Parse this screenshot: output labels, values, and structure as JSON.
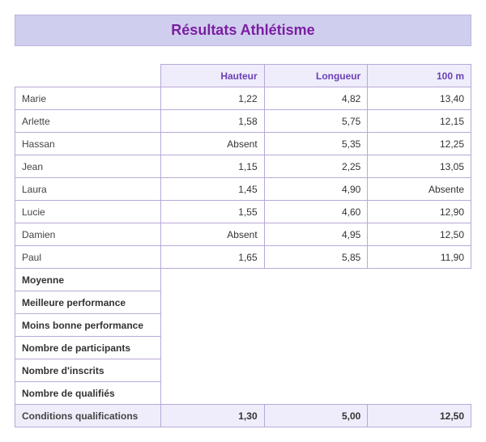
{
  "title": "Résultats Athlétisme",
  "columns": [
    "Hauteur",
    "Longueur",
    "100 m"
  ],
  "rows": [
    {
      "name": "Marie",
      "values": [
        "1,22",
        "4,82",
        "13,40"
      ]
    },
    {
      "name": "Arlette",
      "values": [
        "1,58",
        "5,75",
        "12,15"
      ]
    },
    {
      "name": "Hassan",
      "values": [
        "Absent",
        "5,35",
        "12,25"
      ]
    },
    {
      "name": "Jean",
      "values": [
        "1,15",
        "2,25",
        "13,05"
      ]
    },
    {
      "name": "Laura",
      "values": [
        "1,45",
        "4,90",
        "Absente"
      ]
    },
    {
      "name": "Lucie",
      "values": [
        "1,55",
        "4,60",
        "12,90"
      ]
    },
    {
      "name": "Damien",
      "values": [
        "Absent",
        "4,95",
        "12,50"
      ]
    },
    {
      "name": "Paul",
      "values": [
        "1,65",
        "5,85",
        "11,90"
      ]
    }
  ],
  "summary_rows": [
    "Moyenne",
    "Meilleure performance",
    "Moins bonne performance",
    "Nombre de participants",
    "Nombre d'inscrits",
    "Nombre de qualifiés"
  ],
  "qualification": {
    "label": "Conditions qualifications",
    "values": [
      "1,30",
      "5,00",
      "12,50"
    ]
  },
  "chart_data": {
    "type": "table",
    "title": "Résultats Athlétisme",
    "columns": [
      "Hauteur",
      "Longueur",
      "100 m"
    ],
    "series": [
      {
        "name": "Marie",
        "values": [
          1.22,
          4.82,
          13.4
        ]
      },
      {
        "name": "Arlette",
        "values": [
          1.58,
          5.75,
          12.15
        ]
      },
      {
        "name": "Hassan",
        "values": [
          null,
          5.35,
          12.25
        ]
      },
      {
        "name": "Jean",
        "values": [
          1.15,
          2.25,
          13.05
        ]
      },
      {
        "name": "Laura",
        "values": [
          1.45,
          4.9,
          null
        ]
      },
      {
        "name": "Lucie",
        "values": [
          1.55,
          4.6,
          12.9
        ]
      },
      {
        "name": "Damien",
        "values": [
          null,
          4.95,
          12.5
        ]
      },
      {
        "name": "Paul",
        "values": [
          1.65,
          5.85,
          11.9
        ]
      }
    ],
    "qualification_thresholds": {
      "Hauteur": 1.3,
      "Longueur": 5.0,
      "100 m": 12.5
    }
  }
}
